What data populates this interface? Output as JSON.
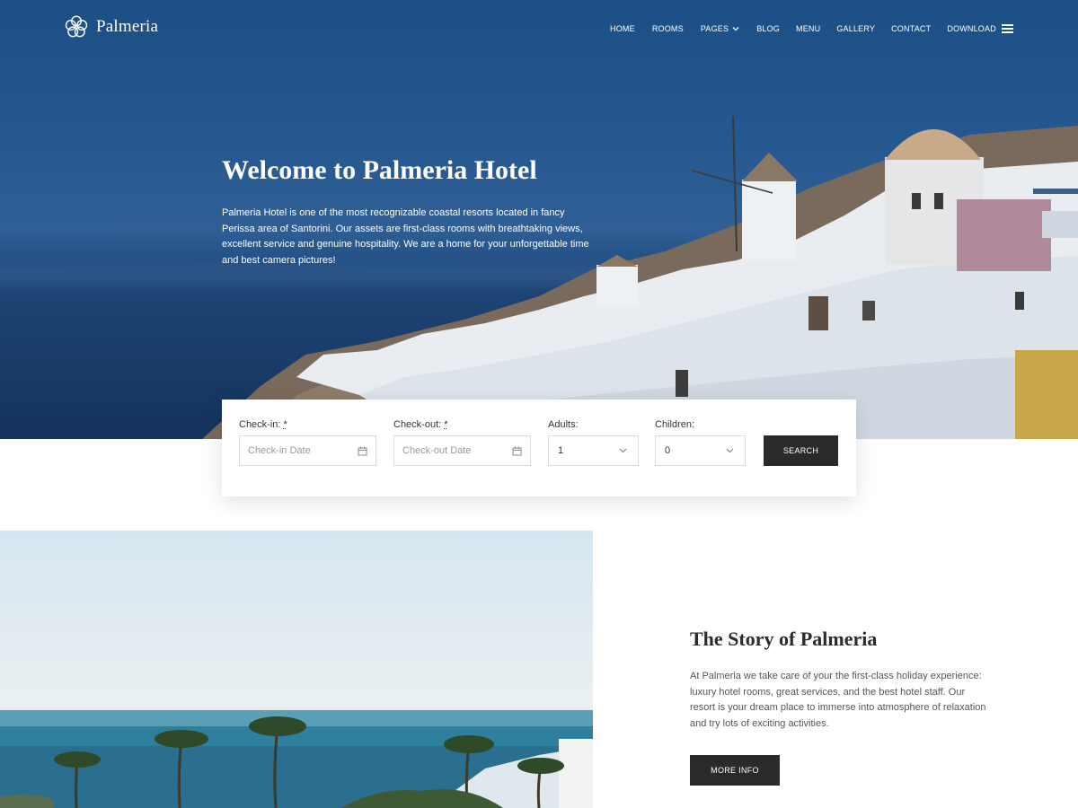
{
  "brand": {
    "name": "Palmeria",
    "logo_icon": "flower-knot-icon"
  },
  "nav": {
    "items": [
      {
        "label": "HOME"
      },
      {
        "label": "ROOMS"
      },
      {
        "label": "PAGES",
        "has_dropdown": true
      },
      {
        "label": "BLOG"
      },
      {
        "label": "MENU"
      },
      {
        "label": "GALLERY"
      },
      {
        "label": "CONTACT"
      },
      {
        "label": "DOWNLOAD"
      }
    ],
    "menu_icon": "hamburger-icon"
  },
  "hero": {
    "title": "Welcome to Palmeria Hotel",
    "description": "Palmeria Hotel is one of the most recognizable coastal resorts located in fancy Perissa area of Santorini. Our assets are first-class rooms with breathtaking views, excellent service and genuine hospitality. We are a home for your unforgettable time and best camera pictures!"
  },
  "booking": {
    "checkin": {
      "label": "Check-in:",
      "required_mark": "*",
      "placeholder": "Check-in Date",
      "icon": "calendar-icon"
    },
    "checkout": {
      "label": "Check-out:",
      "required_mark": "*",
      "placeholder": "Check-out Date",
      "icon": "calendar-icon"
    },
    "adults": {
      "label": "Adults:",
      "value": "1"
    },
    "children": {
      "label": "Children:",
      "value": "0"
    },
    "search_label": "SEARCH"
  },
  "story": {
    "title": "The Story of Palmeria",
    "text": "At Palmeria we take care of your the first-class holiday experience: luxury hotel rooms, great services, and the best hotel staff. Our resort is your dream place to immerse into atmosphere of relaxation and try lots of exciting activities.",
    "button_label": "MORE INFO"
  },
  "colors": {
    "hero_blue": "#24578f",
    "button_dark": "#2a2a2a",
    "text_dark": "#2b2b2b",
    "text_muted": "#555555"
  }
}
